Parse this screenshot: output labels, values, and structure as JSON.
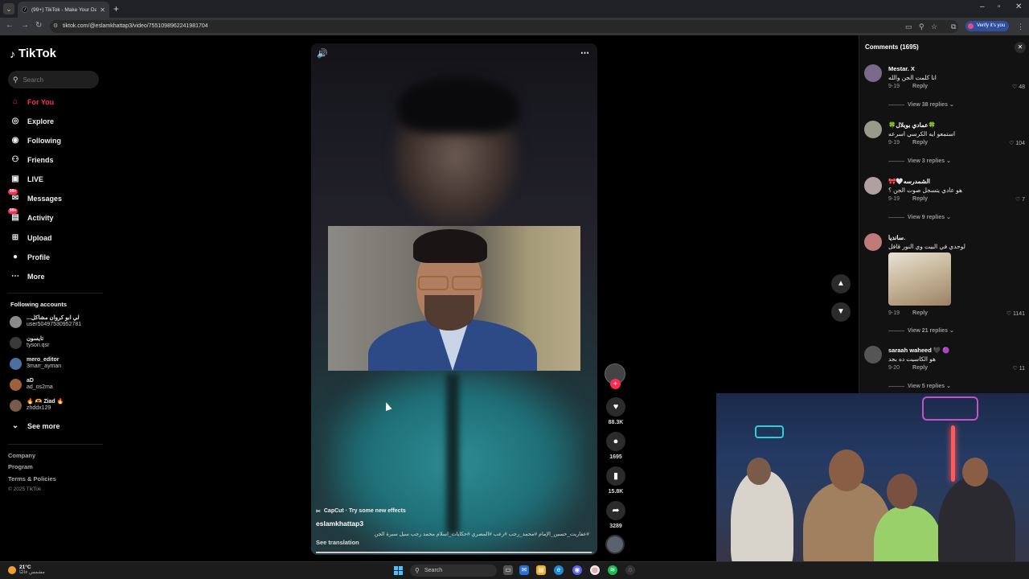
{
  "browser": {
    "tab_title": "(99+) TikTok - Make Your Day",
    "url": "tiktok.com/@eslamkhattap3/video/7551098962241981704",
    "verify_label": "Verify it's you"
  },
  "sidebar": {
    "brand": "TikTok",
    "search_placeholder": "Search",
    "nav": [
      {
        "label": "For You",
        "icon": "home-icon"
      },
      {
        "label": "Explore",
        "icon": "compass-icon"
      },
      {
        "label": "Following",
        "icon": "following-icon"
      },
      {
        "label": "Friends",
        "icon": "friends-icon"
      },
      {
        "label": "LIVE",
        "icon": "live-icon"
      },
      {
        "label": "Messages",
        "icon": "messages-icon",
        "badge": "99+"
      },
      {
        "label": "Activity",
        "icon": "activity-icon",
        "badge": "99+"
      },
      {
        "label": "Upload",
        "icon": "upload-icon"
      },
      {
        "label": "Profile",
        "icon": "profile-icon"
      },
      {
        "label": "More",
        "icon": "more-icon"
      }
    ],
    "following_title": "Following accounts",
    "accounts": [
      {
        "name": "...لي ابو كروان مشاكل",
        "user": "user50497530952781"
      },
      {
        "name": "تايسون",
        "user": "tyson.qsr"
      },
      {
        "name": "mero_editor",
        "user": "3marr_ayman"
      },
      {
        "name": "aD",
        "user": "ad_os2ma"
      },
      {
        "name": "🔥 🫶 Ziad 🔥",
        "user": "zhddx129"
      }
    ],
    "see_more": "See more",
    "footer": [
      "Company",
      "Program",
      "Terms & Policies"
    ],
    "copyright": "© 2025 TikTok"
  },
  "video": {
    "capcut": "CapCut · Try some new effects",
    "author": "eslamkhattap3",
    "tags": "#عفاريت_حسين_الإمام #محمد_رجب #رعب #المصري #حكايات_اسلام محمد رجب سيل سيرة الجن",
    "see_translation": "See translation",
    "progress": 0.99,
    "likes": "88.3K",
    "comments": "1695",
    "saves": "15.8K",
    "shares": "3289"
  },
  "comments_panel": {
    "title": "Comments (1695)",
    "items": [
      {
        "name": "Mestar. X",
        "text": "انا كلمت الجن والله",
        "date": "9-19",
        "reply": "Reply",
        "likes": "48",
        "view": "View 38 replies"
      },
      {
        "name": "🍀عمادي بوبلال🍀",
        "text": "استمعو ايه الكرسي اسرعه",
        "date": "9-19",
        "reply": "Reply",
        "likes": "104",
        "view": "View 3 replies"
      },
      {
        "name": "🎀🤍الشمدرسه",
        "text": "هو عادي يتسجل صوت الجن ؟",
        "date": "9-19",
        "reply": "Reply",
        "likes": "7",
        "view": "View 9 replies"
      },
      {
        "name": "سانديا.",
        "text": "لوحدي في البيت وي النور قافل",
        "date": "9-19",
        "reply": "Reply",
        "likes": "1141",
        "view": "View 21 replies"
      },
      {
        "name": "saraah waheed 🖤 🟣",
        "text": "هو الكاسيت ده بجد",
        "date": "9-20",
        "reply": "Reply",
        "likes": "11",
        "view": "View 5 replies"
      }
    ]
  },
  "taskbar": {
    "temp": "21°C",
    "weather": "مشمس غالبًا",
    "search": "Search"
  }
}
